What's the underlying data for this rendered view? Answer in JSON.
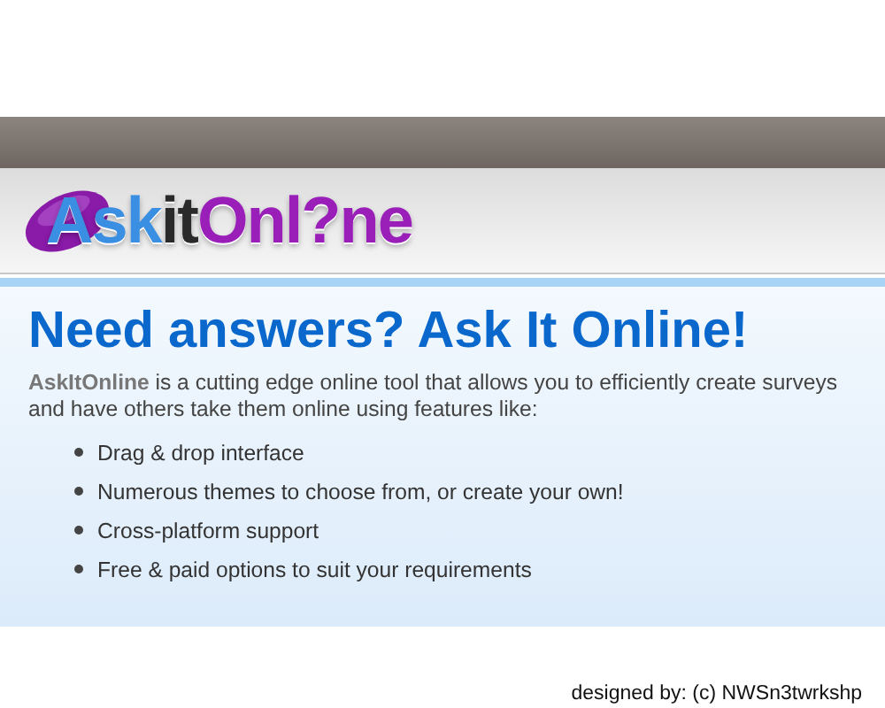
{
  "logo": {
    "parts": [
      {
        "text": "Ask",
        "color": "#3b8fe3"
      },
      {
        "text": "it",
        "color": "#2a2a2a"
      },
      {
        "text": "Onl?ne",
        "color": "#9a1fb8"
      }
    ]
  },
  "headline": "Need answers? Ask It Online!",
  "intro": "**AskItOnline** is a cutting edge online tool that allows you to efficiently create surveys and have others take them online using features like:",
  "features": [
    "Drag & drop interface",
    "Numerous themes to choose from, or create your own!",
    "Cross-platform support",
    "Free & paid options to suit your requirements"
  ],
  "footer": "designed by: (c) NWSn3twrkshp"
}
